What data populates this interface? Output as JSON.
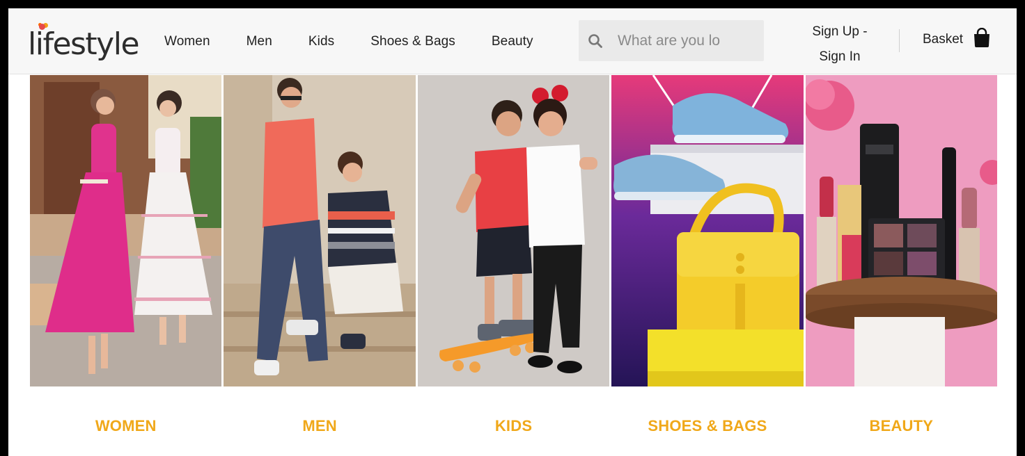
{
  "brand": {
    "logo_text": "lifestyle"
  },
  "nav": [
    "Women",
    "Men",
    "Kids",
    "Shoes & Bags",
    "Beauty"
  ],
  "search": {
    "placeholder": "What are you lo",
    "icon": "search-icon"
  },
  "account": {
    "signup_line1": "Sign Up -",
    "signin_line2": "Sign In"
  },
  "basket": {
    "label": "Basket",
    "icon": "shopping-bag-icon"
  },
  "categories": [
    {
      "label": "WOMEN",
      "image": "women-category-image"
    },
    {
      "label": "MEN",
      "image": "men-category-image"
    },
    {
      "label": "KIDS",
      "image": "kids-category-image"
    },
    {
      "label": "SHOES & BAGS",
      "image": "shoes-bags-category-image"
    },
    {
      "label": "BEAUTY",
      "image": "beauty-category-image"
    }
  ],
  "colors": {
    "accent": "#f0a81a",
    "header_bg": "#f7f7f7",
    "search_bg": "#eaeaea"
  }
}
